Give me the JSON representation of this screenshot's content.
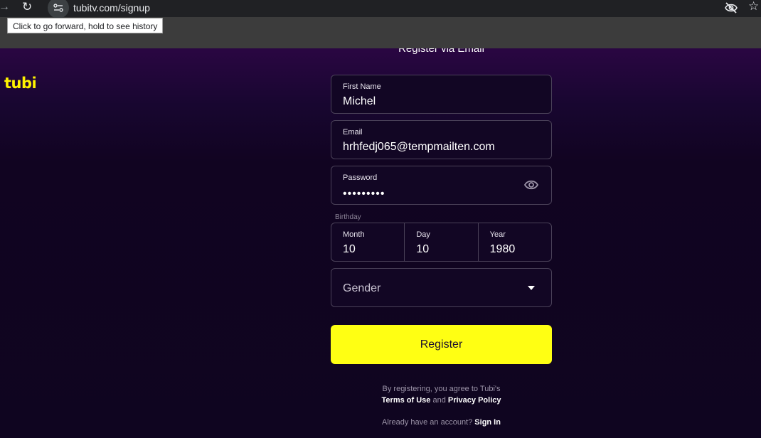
{
  "browser": {
    "url": "tubitv.com/signup",
    "tooltip": "Click to go forward, hold to see history"
  },
  "brand": {
    "logo": "tubi",
    "accent": "#fff200"
  },
  "form": {
    "title": "Register via Email",
    "first_name": {
      "label": "First Name",
      "value": "Michel"
    },
    "email": {
      "label": "Email",
      "value": "hrhfedj065@tempmailten.com"
    },
    "password": {
      "label": "Password",
      "value": "•••••••••"
    },
    "birthday": {
      "label": "Birthday",
      "month": {
        "label": "Month",
        "value": "10"
      },
      "day": {
        "label": "Day",
        "value": "10"
      },
      "year": {
        "label": "Year",
        "value": "1980"
      }
    },
    "gender": {
      "placeholder": "Gender"
    },
    "register_label": "Register",
    "legal_prefix": "By registering, you agree to Tubi's",
    "terms_label": "Terms of Use",
    "legal_and": "and",
    "privacy_label": "Privacy Policy",
    "signin_prefix": "Already have an account?",
    "signin_label": "Sign In"
  }
}
